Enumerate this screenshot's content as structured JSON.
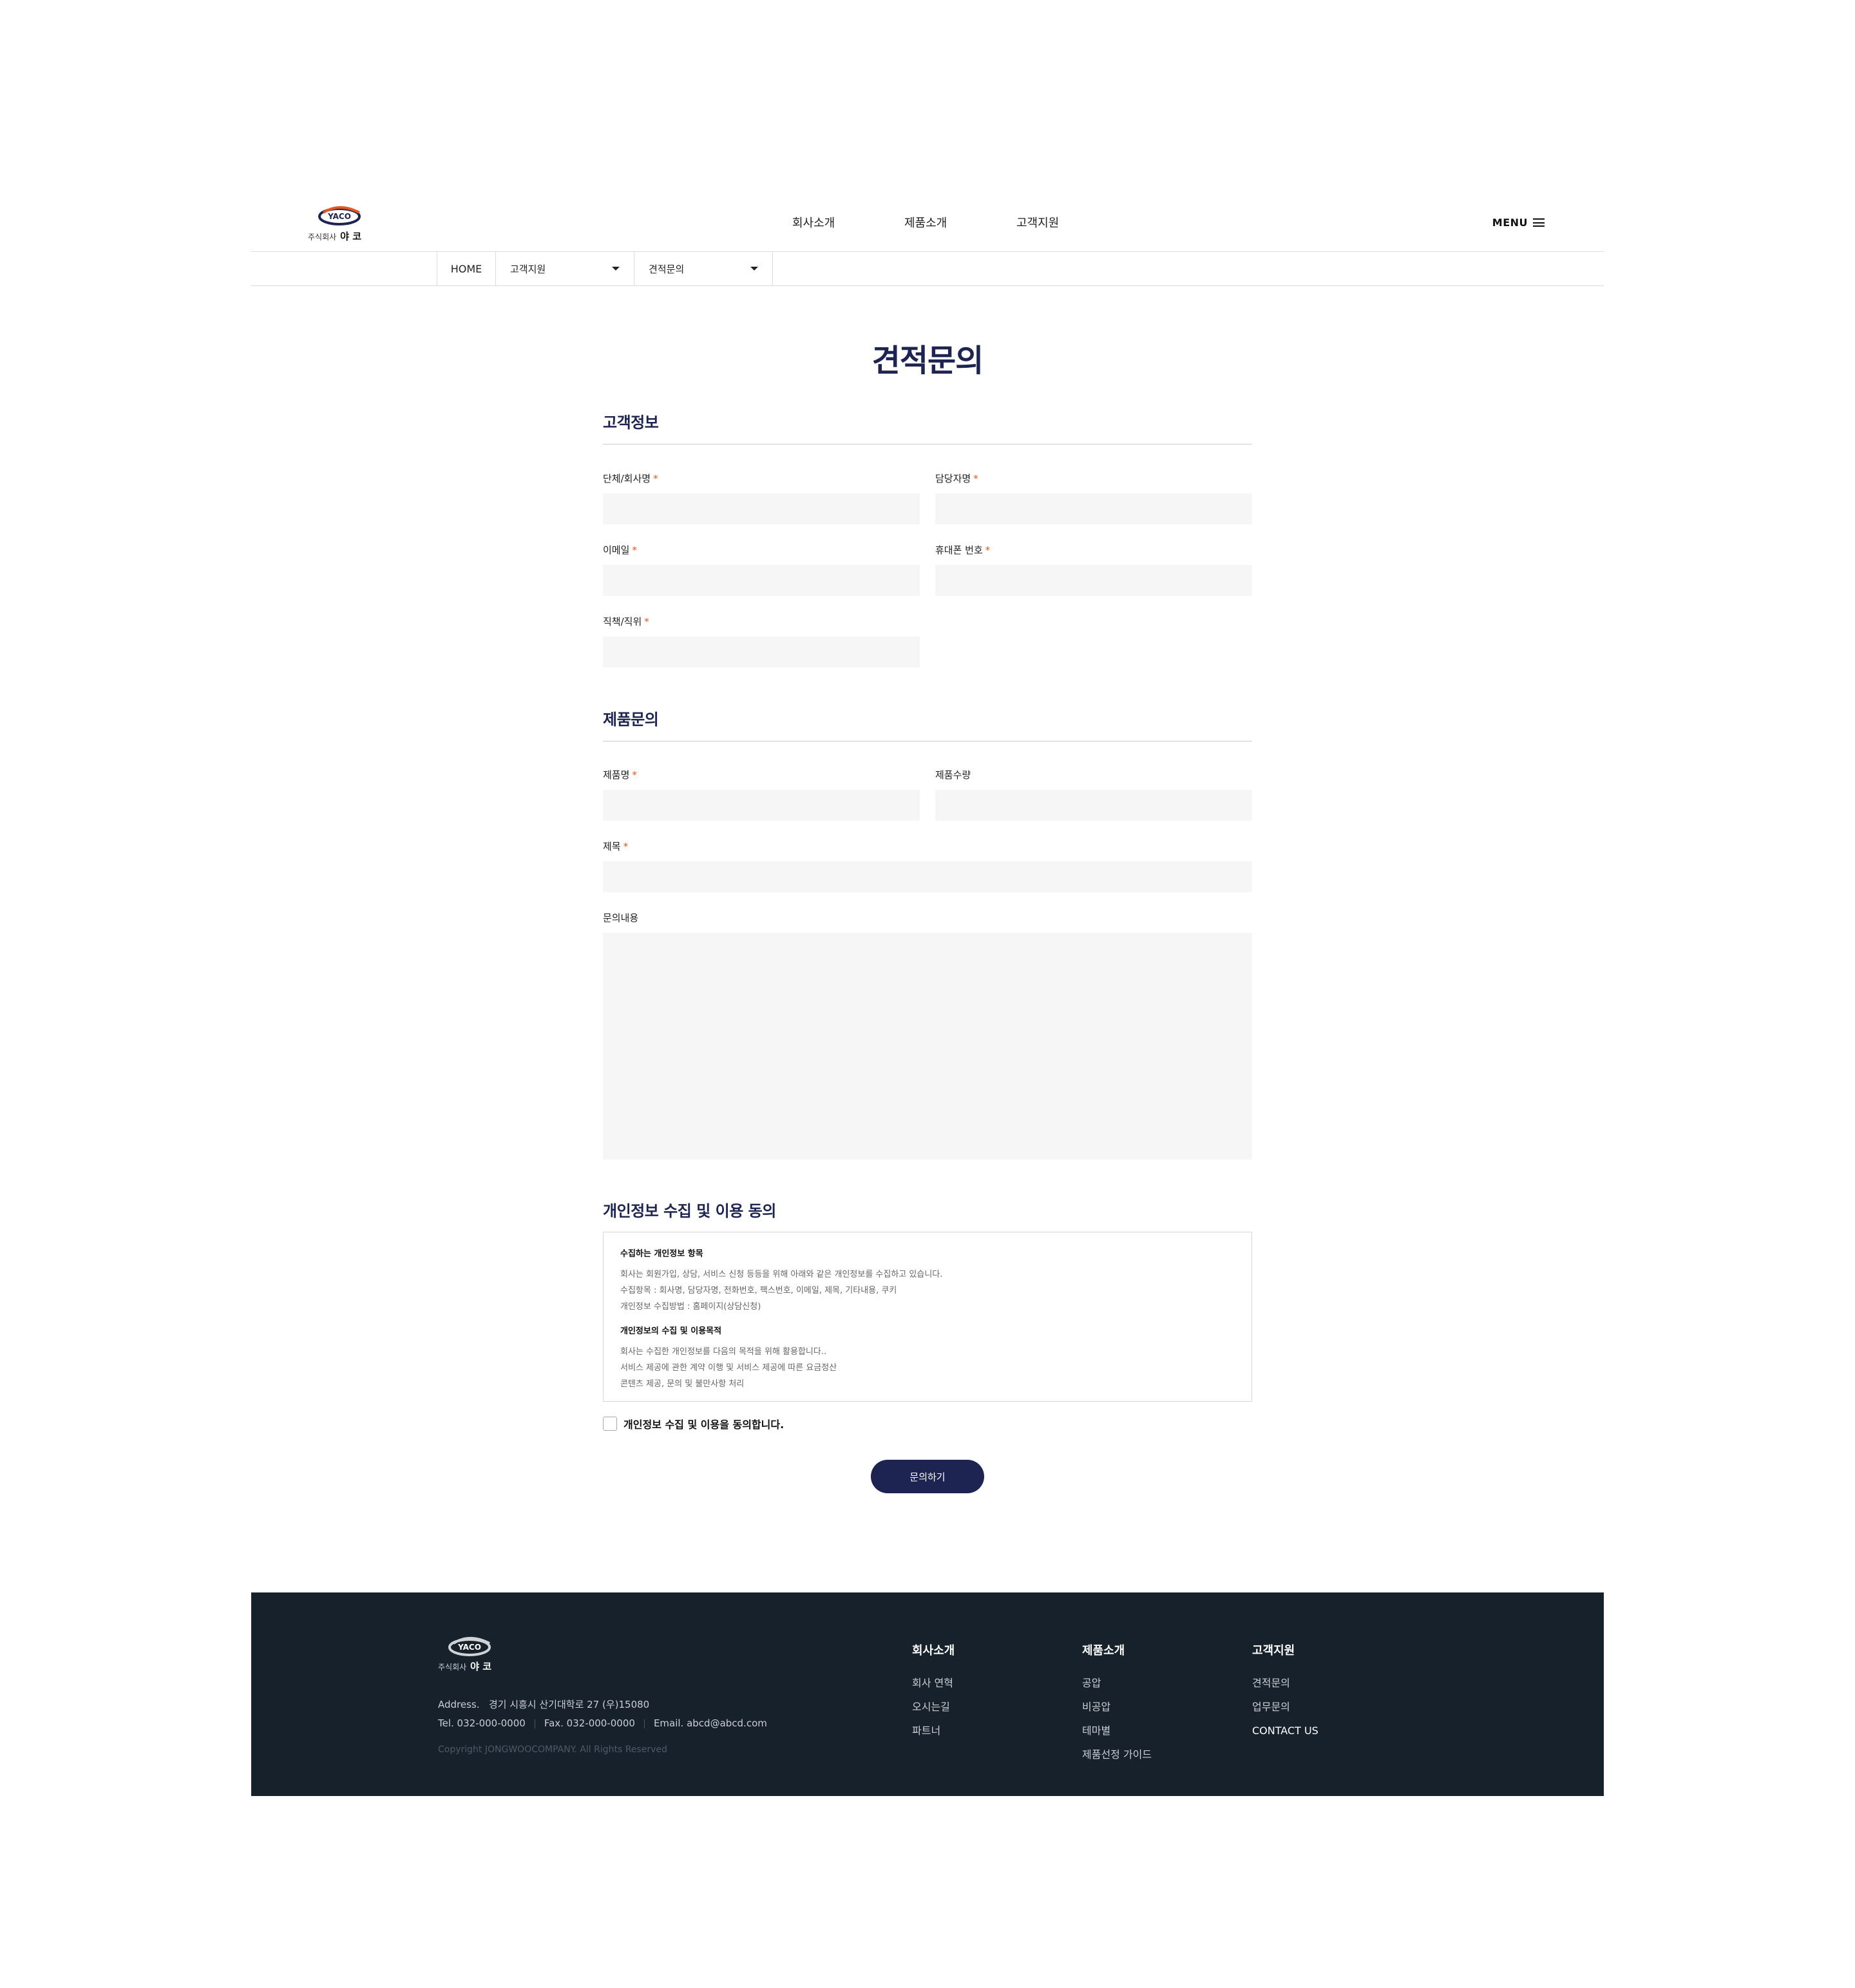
{
  "brand": {
    "logo_text": "YACO",
    "company_prefix": "주식회사",
    "company_name": "야 코"
  },
  "nav": {
    "items": [
      "회사소개",
      "제품소개",
      "고객지원"
    ],
    "menu_label": "MENU"
  },
  "breadcrumb": {
    "home": "HOME",
    "level1": "고객지원",
    "level2": "견적문의"
  },
  "page_title": "견적문의",
  "customer_section": {
    "title": "고객정보",
    "fields": {
      "company": {
        "label": "단체/회사명",
        "required": "*",
        "value": ""
      },
      "manager": {
        "label": "담당자명",
        "required": "*",
        "value": ""
      },
      "email": {
        "label": "이메일",
        "required": "*",
        "value": ""
      },
      "phone": {
        "label": "휴대폰 번호",
        "required": "*",
        "value": ""
      },
      "position": {
        "label": "직책/직위",
        "required": "*",
        "value": ""
      }
    }
  },
  "product_section": {
    "title": "제품문의",
    "fields": {
      "product_name": {
        "label": "제품명",
        "required": "*",
        "value": ""
      },
      "quantity": {
        "label": "제품수량",
        "value": ""
      },
      "subject": {
        "label": "제목",
        "required": "*",
        "value": ""
      },
      "content": {
        "label": "문의내용",
        "value": ""
      }
    }
  },
  "privacy": {
    "title": "개인정보 수집 및 이용 동의",
    "items_heading": "수집하는 개인정보 항목",
    "items_lines": [
      "회사는 회원가입, 상담, 서비스 신청 등등을 위해 아래와 같은 개인정보를 수집하고 있습니다.",
      "수집항목 : 회사명, 담당자명, 전화번호, 팩스번호, 이메일, 제목, 기타내용, 쿠키",
      "개인정보 수집방법 : 홈페이지(상담신청)"
    ],
    "purpose_heading": "개인정보의 수집 및 이용목적",
    "purpose_lines": [
      "회사는 수집한 개인정보를 다음의 목적을 위해 활용합니다..",
      "서비스 제공에 관한 계약 이행 및 서비스 제공에 따른 요금정산",
      "콘텐츠 제공, 문의 및 불만사항 처리"
    ],
    "agree_label": "개인정보 수집 및 이용을 동의합니다.",
    "agree_checked": false
  },
  "submit_label": "문의하기",
  "footer": {
    "address_label": "Address.",
    "address": "경기 시흥시 산기대학로 27 (우)15080",
    "tel": "Tel. 032-000-0000",
    "fax": "Fax. 032-000-0000",
    "email": "Email. abcd@abcd.com",
    "copyright": "Copyright JONGWOOCOMPANY. All Rights Reserved",
    "columns": [
      {
        "title": "회사소개",
        "links": [
          "회사 연혁",
          "오시는길",
          "파트너"
        ]
      },
      {
        "title": "제품소개",
        "links": [
          "공압",
          "비공압",
          "테마별",
          "제품선정 가이드"
        ]
      },
      {
        "title": "고객지원",
        "links": [
          "견적문의",
          "업무문의",
          "CONTACT US"
        ]
      }
    ]
  },
  "colors": {
    "navy": "#1d2452",
    "required": "#e2581f",
    "footer_bg": "#17212c",
    "input_bg": "#f6f6f6",
    "logo_orange": "#e2581f"
  }
}
